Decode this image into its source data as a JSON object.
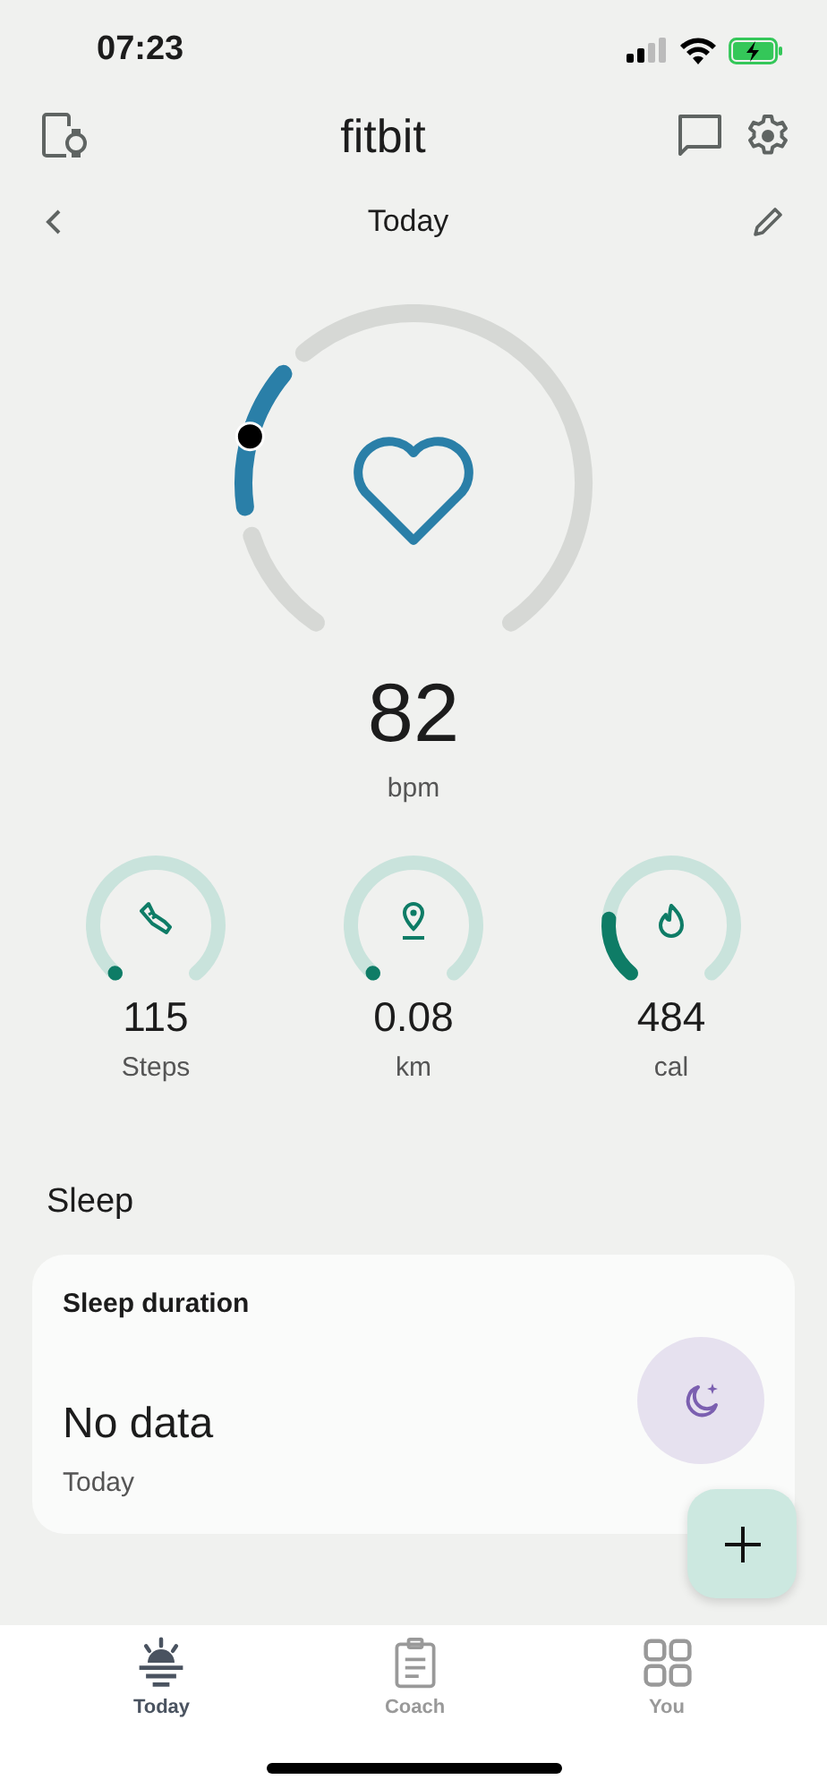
{
  "status_bar": {
    "time": "07:23"
  },
  "header": {
    "title": "fitbit"
  },
  "date_nav": {
    "label": "Today"
  },
  "heart_rate": {
    "value": "82",
    "unit": "bpm"
  },
  "stats": [
    {
      "kind": "steps",
      "value": "115",
      "label": "Steps"
    },
    {
      "kind": "distance",
      "value": "0.08",
      "label": "km"
    },
    {
      "kind": "calories",
      "value": "484",
      "label": "cal"
    }
  ],
  "sleep": {
    "heading": "Sleep",
    "card_title": "Sleep duration",
    "value": "No data",
    "date": "Today"
  },
  "bottom_nav": [
    {
      "kind": "today",
      "label": "Today",
      "selected": true
    },
    {
      "kind": "coach",
      "label": "Coach",
      "selected": false
    },
    {
      "kind": "you",
      "label": "You",
      "selected": false
    }
  ]
}
